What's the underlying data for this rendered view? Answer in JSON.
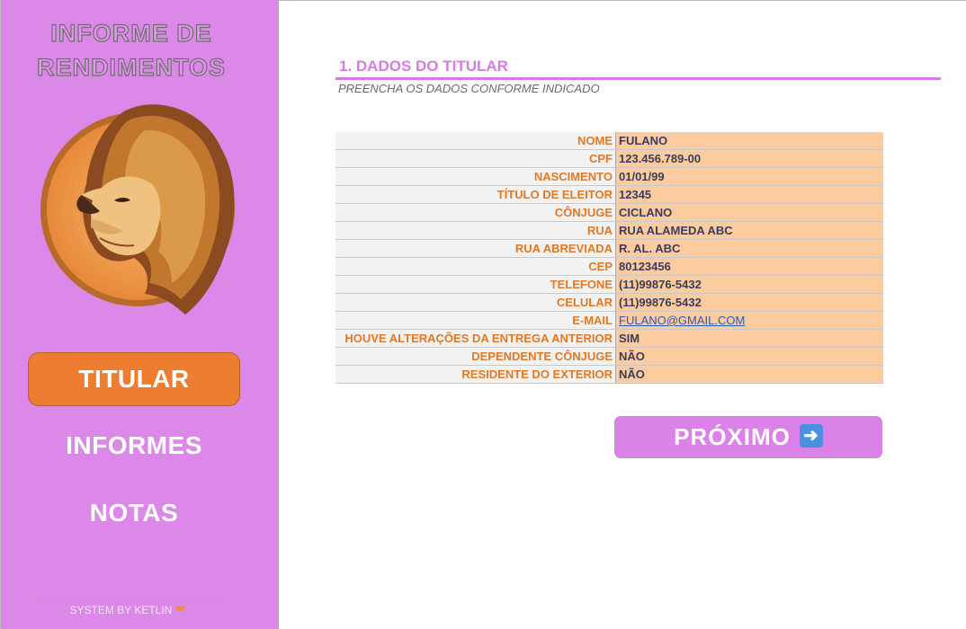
{
  "sidebar": {
    "title_line1": "INFORME DE",
    "title_line2": "RENDIMENTOS",
    "logo_icon": "lion-head-icon",
    "nav": [
      {
        "label": "TITULAR",
        "active": true
      },
      {
        "label": "INFORMES",
        "active": false
      },
      {
        "label": "NOTAS",
        "active": false
      }
    ],
    "footer": "SYSTEM BY KETLIN",
    "footer_icon": "heart-icon"
  },
  "main": {
    "section_title": "1. DADOS DO TITULAR",
    "section_subtitle": "PREENCHA OS DADOS CONFORME INDICADO",
    "fields": [
      {
        "label": "NOME",
        "value": "FULANO"
      },
      {
        "label": "CPF",
        "value": "123.456.789-00"
      },
      {
        "label": "NASCIMENTO",
        "value": "01/01/99"
      },
      {
        "label": "TÍTULO DE ELEITOR",
        "value": "12345"
      },
      {
        "label": "CÔNJUGE",
        "value": "CICLANO"
      },
      {
        "label": "RUA",
        "value": "RUA ALAMEDA ABC"
      },
      {
        "label": "RUA ABREVIADA",
        "value": "R. AL. ABC"
      },
      {
        "label": "CEP",
        "value": "80123456"
      },
      {
        "label": "TELEFONE",
        "value": "(11)99876-5432"
      },
      {
        "label": "CELULAR",
        "value": "(11)99876-5432"
      },
      {
        "label": "E-MAIL",
        "value": "FULANO@GMAIL.COM"
      },
      {
        "label": "HOUVE ALTERAÇÕES DA ENTREGA ANTERIOR",
        "value": "SIM"
      },
      {
        "label": "DEPENDENTE CÔNJUGE",
        "value": "NÃO"
      },
      {
        "label": "RESIDENTE DO EXTERIOR",
        "value": "NÃO"
      }
    ],
    "next_button": {
      "label": "PRÓXIMO",
      "icon": "arrow-right-icon"
    }
  },
  "colors": {
    "sidebar_bg": "#db88e8",
    "accent_orange": "#ed7d31",
    "label_orange": "#e37825",
    "value_bg": "#fdcc9e",
    "title_purple": "#d47de3"
  }
}
